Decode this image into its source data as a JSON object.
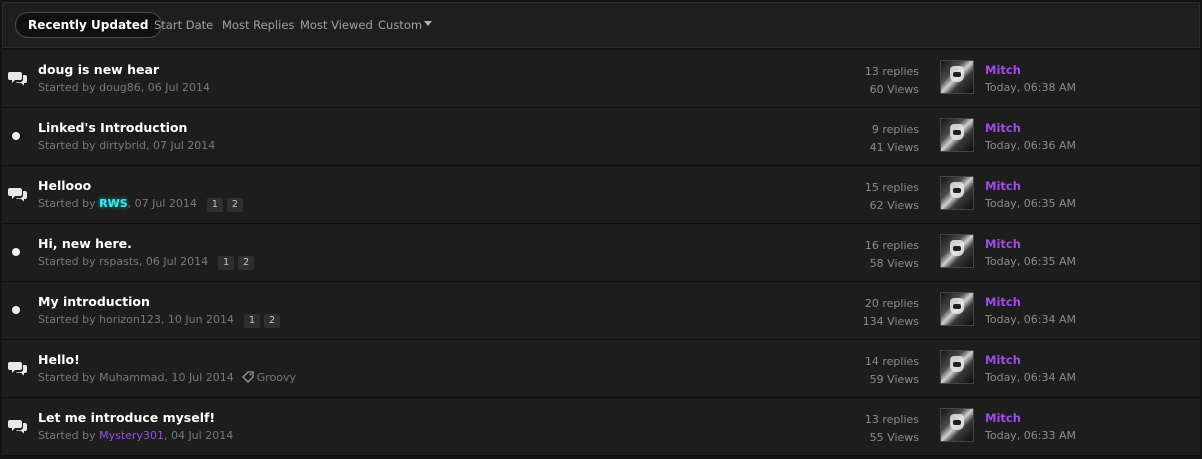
{
  "filters": {
    "active": "Recently Updated",
    "tabs": [
      "Start Date",
      "Most Replies",
      "Most Viewed",
      "Custom"
    ]
  },
  "colors": {
    "group_purple": "#a24be8",
    "group_cyan": "#3ee8ef",
    "row_bg": "#1d1d1d"
  },
  "topics": [
    {
      "icon": "chat-bubbles-icon",
      "title": "doug is new hear",
      "started_prefix": "Started by ",
      "author": "doug86",
      "author_style": "plain",
      "date": ", 06 Jul 2014",
      "pages": [],
      "tag": "",
      "replies": "13 replies",
      "views": "60 Views",
      "last_poster": "Mitch",
      "last_time": "Today, 06:38 AM"
    },
    {
      "icon": "bullet-dot-icon",
      "title": "Linked's Introduction",
      "started_prefix": "Started by ",
      "author": "dirtybrid",
      "author_style": "plain",
      "date": ", 07 Jul 2014",
      "pages": [],
      "tag": "",
      "replies": "9 replies",
      "views": "41 Views",
      "last_poster": "Mitch",
      "last_time": "Today, 06:36 AM"
    },
    {
      "icon": "chat-bubbles-icon",
      "title": "Hellooo",
      "started_prefix": "Started by ",
      "author": "RWS",
      "author_style": "cyan",
      "date": ", 07 Jul 2014",
      "pages": [
        "1",
        "2"
      ],
      "tag": "",
      "replies": "15 replies",
      "views": "62 Views",
      "last_poster": "Mitch",
      "last_time": "Today, 06:35 AM"
    },
    {
      "icon": "bullet-dot-icon",
      "title": "Hi, new here.",
      "started_prefix": "Started by ",
      "author": "rspasts",
      "author_style": "plain",
      "date": ", 06 Jul 2014",
      "pages": [
        "1",
        "2"
      ],
      "tag": "",
      "replies": "16 replies",
      "views": "58 Views",
      "last_poster": "Mitch",
      "last_time": "Today, 06:35 AM"
    },
    {
      "icon": "bullet-dot-icon",
      "title": "My introduction",
      "started_prefix": "Started by ",
      "author": "horizon123",
      "author_style": "plain",
      "date": ", 10 Jun 2014",
      "pages": [
        "1",
        "2"
      ],
      "tag": "",
      "replies": "20 replies",
      "views": "134 Views",
      "last_poster": "Mitch",
      "last_time": "Today, 06:34 AM"
    },
    {
      "icon": "chat-bubbles-icon",
      "title": "Hello!",
      "started_prefix": "Started by ",
      "author": "Muhammad",
      "author_style": "plain",
      "date": ", 10 Jul 2014",
      "pages": [],
      "tag": "Groovy",
      "replies": "14 replies",
      "views": "59 Views",
      "last_poster": "Mitch",
      "last_time": "Today, 06:34 AM"
    },
    {
      "icon": "chat-bubbles-icon",
      "title": "Let me introduce myself!",
      "started_prefix": "Started by ",
      "author": "Mystery301",
      "author_style": "purple",
      "date": ", 04 Jul 2014",
      "pages": [],
      "tag": "",
      "replies": "13 replies",
      "views": "55 Views",
      "last_poster": "Mitch",
      "last_time": "Today, 06:33 AM"
    }
  ]
}
